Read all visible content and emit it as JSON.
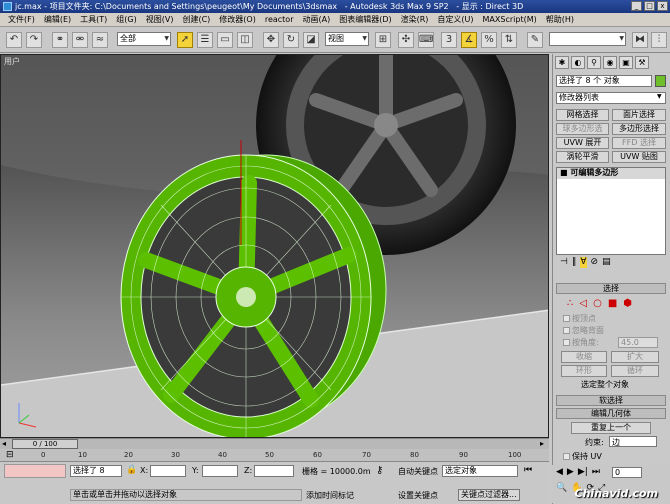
{
  "window": {
    "icon_label": "jc.max",
    "title": " - 项目文件夹: C:\\Documents and Settings\\peugeot\\My Documents\\3dsmax   - Autodesk 3ds Max 9 SP2   - 显示 : Direct 3D"
  },
  "menu": [
    "文件(F)",
    "编辑(E)",
    "工具(T)",
    "组(G)",
    "视图(V)",
    "创建(C)",
    "修改器(O)",
    "reactor",
    "动画(A)",
    "图表编辑器(D)",
    "渲染(R)",
    "自定义(U)",
    "MAXScript(M)",
    "帮助(H)"
  ],
  "toolbar": {
    "selection_filter": "全部",
    "reference_coord": "视图"
  },
  "viewport": {
    "label": "用户"
  },
  "panel": {
    "selection_count": "选择了 8 个 对象",
    "modifier_list": "修改器列表",
    "buttons": [
      "网格选择",
      "面片选择",
      "球多边形选",
      "多边形选择",
      "UVW 展开",
      "FFD 选择",
      "涡轮平滑",
      "UVW 贴图"
    ],
    "stack_item": "可编辑多边形",
    "rollout_select": "选择",
    "check_vertex": "按顶点",
    "check_backface": "忽略背面",
    "check_angle": "按角度:",
    "angle_value": "45.0",
    "btn_shrink": "收缩",
    "btn_grow": "扩大",
    "btn_ring": "环形",
    "btn_loop": "循环",
    "select_info": "选定整个对象",
    "rollout_soft": "软选择",
    "rollout_edit": "编辑几何体",
    "repeat_last": "重复上一个",
    "constraint_label": "约束:",
    "constraint_value": "边",
    "preserve_uv": "保持 UV"
  },
  "timeline": {
    "frame": "0 / 100",
    "ticks": [
      "0",
      "10",
      "20",
      "30",
      "40",
      "50",
      "60",
      "70",
      "80",
      "90",
      "100"
    ]
  },
  "status": {
    "selected": "选择了 8",
    "x_label": "X:",
    "y_label": "Y:",
    "z_label": "Z:",
    "grid": "栅格 = 10000.0m",
    "autokey": "自动关键点",
    "selected_object": "选定对象",
    "set_key": "设置关键点",
    "key_filter": "关键点过滤器...",
    "prompt": "单击或单击并拖动以选择对象",
    "add_time_tag": "添加时间标记",
    "frame_value": "0"
  },
  "watermark": "Chinavid.com"
}
